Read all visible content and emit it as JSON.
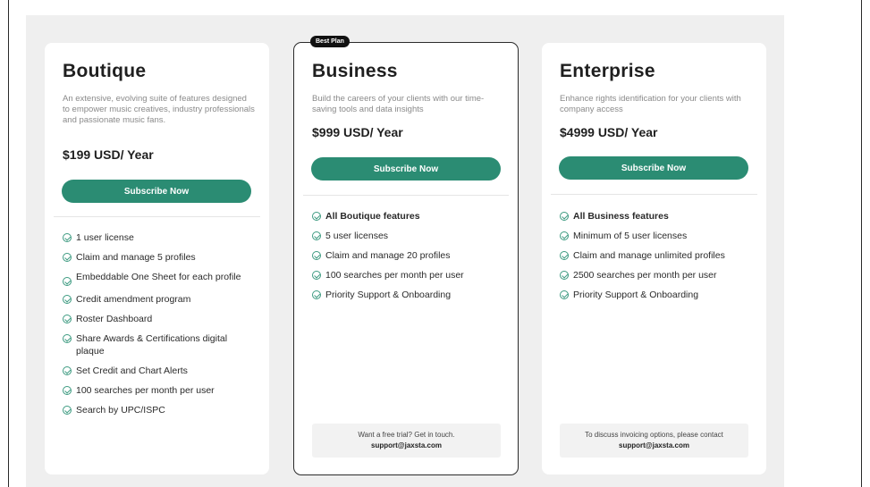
{
  "accent_color": "#2b8c73",
  "plans": [
    {
      "title": "Boutique",
      "description": "An extensive, evolving suite of features designed to empower music creatives, industry professionals and passionate music fans.",
      "price": "$199 USD/ Year",
      "cta": "Subscribe Now",
      "features": [
        "1 user license",
        "Claim and manage 5 profiles",
        "Embeddable One Sheet for each profile",
        "Credit amendment program",
        "Roster Dashboard",
        "Share Awards & Certifications digital plaque",
        "Set Credit and Chart Alerts",
        "100 searches per month per user",
        "Search by UPC/ISPC"
      ]
    },
    {
      "badge": "Best Plan",
      "title": "Business",
      "description": "Build the careers of your clients with our time-saving tools and data insights",
      "price": "$999 USD/ Year",
      "cta": "Subscribe Now",
      "features": [
        "All Boutique features",
        "5 user licenses",
        "Claim and manage 20 profiles",
        "100 searches per month per user",
        "Priority Support & Onboarding"
      ],
      "note_text": "Want a free trial? Get in touch.",
      "note_email": "support@jaxsta.com"
    },
    {
      "title": "Enterprise",
      "description": "Enhance rights identification for your clients with company access",
      "price": "$4999 USD/ Year",
      "cta": "Subscribe Now",
      "features": [
        "All Business features",
        "Minimum of 5 user licenses",
        "Claim and manage unlimited profiles",
        "2500 searches per month per user",
        "Priority Support & Onboarding"
      ],
      "note_text": "To discuss invoicing options, please contact",
      "note_email": "support@jaxsta.com"
    }
  ]
}
